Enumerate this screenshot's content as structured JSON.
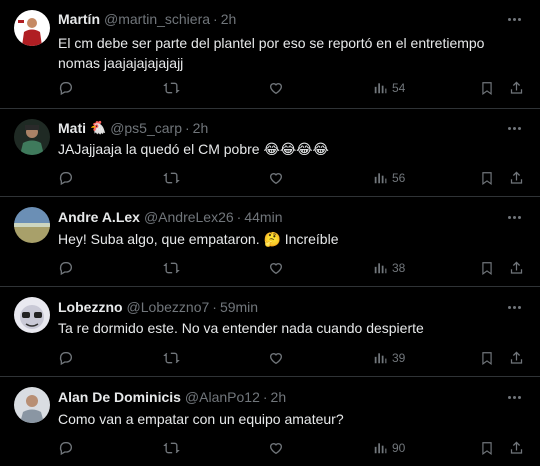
{
  "tweets": [
    {
      "name": "Martín",
      "handle": "@martin_schiera",
      "sep": "·",
      "time": "2h",
      "badge": "",
      "text": "El cm debe ser parte del plantel por eso se reportó en el entretiempo nomas jaajajajajajajj",
      "views": "54",
      "avatar_color": "#b01e23"
    },
    {
      "name": "Mati",
      "handle": "@ps5_carp",
      "sep": "·",
      "time": "2h",
      "badge": "🐔",
      "text": "JAJajjaaja la quedó el CM pobre 😂😂😂😂",
      "views": "56",
      "avatar_color": "#2b4a3a"
    },
    {
      "name": "Andre A.Lex",
      "handle": "@AndreLex26",
      "sep": "·",
      "time": "44min",
      "badge": "",
      "text": "Hey! Suba algo, que empataron. 🤔 Increíble",
      "views": "38",
      "avatar_color": "#6b8fb5"
    },
    {
      "name": "Lobezzno",
      "handle": "@Lobezzno7",
      "sep": "·",
      "time": "59min",
      "badge": "",
      "text": "Ta re dormido este. No va entender nada cuando despierte",
      "views": "39",
      "avatar_color": "#c9c9d6"
    },
    {
      "name": "Alan De Dominicis",
      "handle": "@AlanPo12",
      "sep": "·",
      "time": "2h",
      "badge": "",
      "text": "Como van a empatar con un equipo amateur?",
      "views": "90",
      "avatar_color": "#8a96a3"
    }
  ],
  "colors": {
    "background": "#000000",
    "text": "#e7e9ea",
    "muted": "#71767b",
    "divider": "#2f3336"
  },
  "icons": [
    "more-icon",
    "reply-icon",
    "retweet-icon",
    "like-icon",
    "views-icon",
    "bookmark-icon",
    "share-icon"
  ]
}
